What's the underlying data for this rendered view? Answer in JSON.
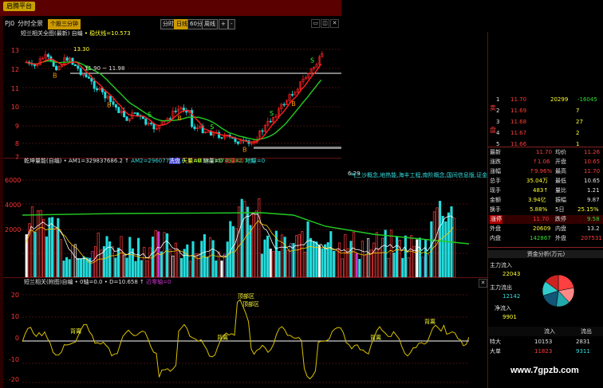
{
  "topbar": {
    "logo_label": "启腾平台"
  },
  "menu": {
    "items": [
      "PJ0",
      "分时",
      "全景"
    ],
    "active_tab": "个股三分钟",
    "period_buttons": [
      "分时",
      "日线",
      "60分",
      "周线"
    ],
    "active_period": "日线",
    "plus_label": "+",
    "minus_label": "-"
  },
  "main_chart": {
    "title": "短兰相关全图(最新) 自编",
    "indicator": "• 稳伏线=10.573",
    "annotations": [
      "13.30",
      "11.90 ~ 11.98",
      "6.29"
    ],
    "y_ticks": [
      "13",
      "12",
      "11",
      "10",
      "9",
      "8",
      "7"
    ],
    "signal_b": "B",
    "signal_s": "S",
    "signal_text": "大不",
    "colors": {
      "up": "#ff2020",
      "down": "#22dddd",
      "ma_green": "#22cc22",
      "ma_red": "#ff2020",
      "ref_line": "#ffffff"
    }
  },
  "volume_chart": {
    "title": "乾坤量能(自编) • AM1=329837686.2 ↑",
    "am2": "AM2=296077404.6 ↑",
    "am3": "AM3=135749382.7 ↑",
    "tags": [
      "洗盘",
      "天量=0",
      "缩量=0",
      "放量=0",
      "地量=0"
    ],
    "y_ticks": [
      "6000",
      "4000",
      "2000"
    ],
    "news": "气三沙概念,地热能,海丰工程,南阶概念,国间信息版,证金持股,汇..."
  },
  "osc_chart": {
    "title": "短兰相关(附图)自编 • 0轴=0.0 • D=10.658 ↑",
    "extra": "近零轴=0",
    "y_ticks": [
      "20",
      "10",
      "0",
      "-10",
      "-20"
    ],
    "labels": [
      "顶部区",
      "顶部区",
      "背离",
      "背离",
      "背离",
      "背离"
    ],
    "colors": {
      "line": "#d8c000",
      "zero": "#ffffff"
    }
  },
  "order_book": {
    "sell": [
      {
        "level": "1",
        "price": "11.70",
        "vol": "20299",
        "change": "-16045"
      },
      {
        "level": "2",
        "price": "11.69",
        "vol": "7",
        "change": ""
      },
      {
        "level": "3",
        "price": "11.68",
        "vol": "27",
        "change": ""
      },
      {
        "level": "4",
        "price": "11.67",
        "vol": "2",
        "change": ""
      },
      {
        "level": "5",
        "price": "11.66",
        "vol": "1",
        "change": ""
      }
    ],
    "side_labels": [
      "卖",
      "盘"
    ]
  },
  "quote": {
    "rows": [
      {
        "k1": "最新",
        "v1": "11.70",
        "k2": "均价",
        "v2": "11.26"
      },
      {
        "k1": "涨跌",
        "v1": "↑1.06",
        "k2": "开盘",
        "v2": "10.65"
      },
      {
        "k1": "涨幅",
        "v1": "↑9.96%",
        "k2": "最高",
        "v2": "11.70"
      },
      {
        "k1": "总手",
        "v1": "35.04万",
        "k2": "最低",
        "v2": "10.65"
      },
      {
        "k1": "现手",
        "v1": "483↑",
        "k2": "量比",
        "v2": "1.21"
      },
      {
        "k1": "金额",
        "v1": "3.94亿",
        "k2": "振幅",
        "v2": "9.87"
      },
      {
        "k1": "换手",
        "v1": "5.88%",
        "k2": "5日",
        "v2": "25.15%"
      },
      {
        "k1": "涨停",
        "v1": "11.70",
        "k2": "跌停",
        "v2": "9.58"
      },
      {
        "k1": "外盘",
        "v1": "20609",
        "k2": "内盘",
        "v2": "13.2"
      },
      {
        "k1": "内盘",
        "v1": "142867",
        "k2": "外盘",
        "v2": "207531"
      }
    ]
  },
  "fund_flow": {
    "title": "资金分析(万元)",
    "items": [
      {
        "label": "主力流入",
        "value": "22043"
      },
      {
        "label": "主力流出",
        "value": "12142"
      },
      {
        "label": "净流入",
        "value": "9901"
      }
    ],
    "table_header": [
      "流入",
      "流出"
    ],
    "table_rows": [
      {
        "label": "特大",
        "in": "10153",
        "out": "2831"
      },
      {
        "label": "大单",
        "in": "11823",
        "out": "9311"
      }
    ]
  },
  "watermark": "www.7gpzb.com"
}
